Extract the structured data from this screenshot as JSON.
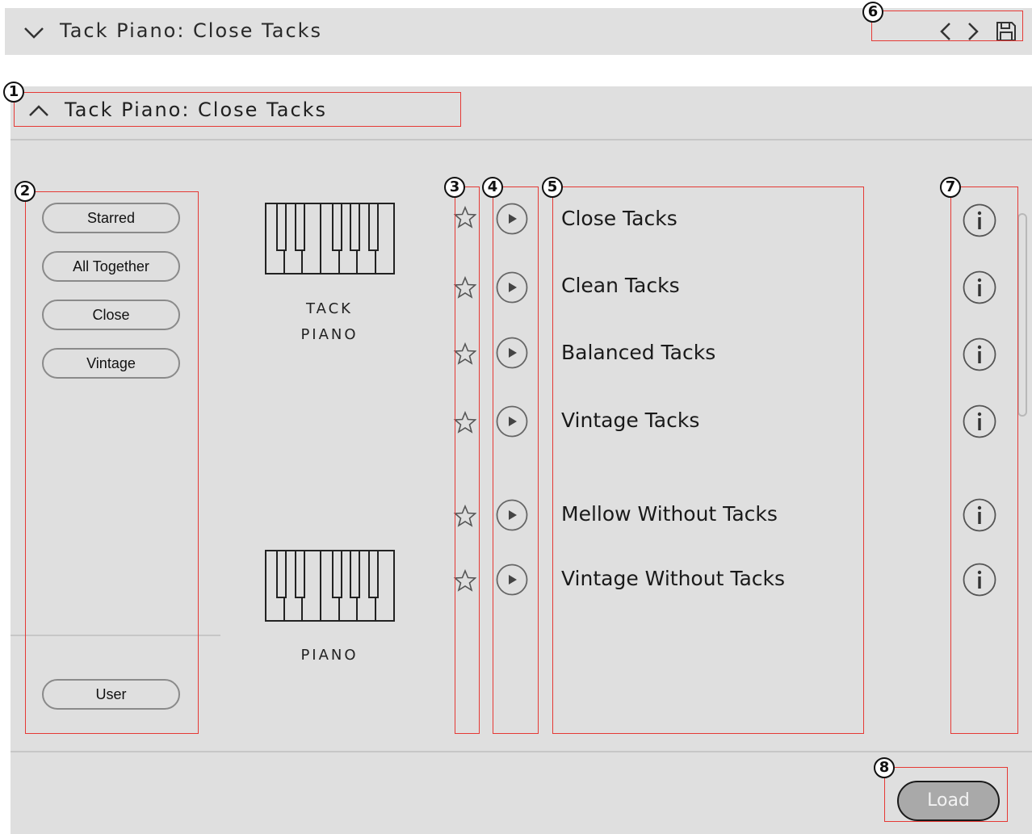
{
  "topbar": {
    "title": "Tack Piano: Close Tacks"
  },
  "panel": {
    "title": "Tack Piano: Close Tacks"
  },
  "tags": [
    "Starred",
    "All Together",
    "Close",
    "Vintage"
  ],
  "user_tag": "User",
  "instruments": [
    {
      "line1": "TACK",
      "line2": "PIANO"
    },
    {
      "line1": "PIANO",
      "line2": ""
    }
  ],
  "presets": [
    "Close Tacks",
    "Clean Tacks",
    "Balanced Tacks",
    "Vintage Tacks",
    "Mellow Without Tacks",
    "Vintage Without Tacks"
  ],
  "load_label": "Load",
  "callouts": [
    "1",
    "2",
    "3",
    "4",
    "5",
    "6",
    "7",
    "8"
  ],
  "colors": {
    "annotation": "#e53935",
    "panel": "#dfdfdf",
    "load_button": "#a9a9a9"
  },
  "icons": [
    "chevron-down-icon",
    "chevron-up-icon",
    "chevron-left-icon",
    "chevron-right-icon",
    "save-icon",
    "star-icon",
    "play-icon",
    "info-icon",
    "piano-keyboard-icon"
  ]
}
